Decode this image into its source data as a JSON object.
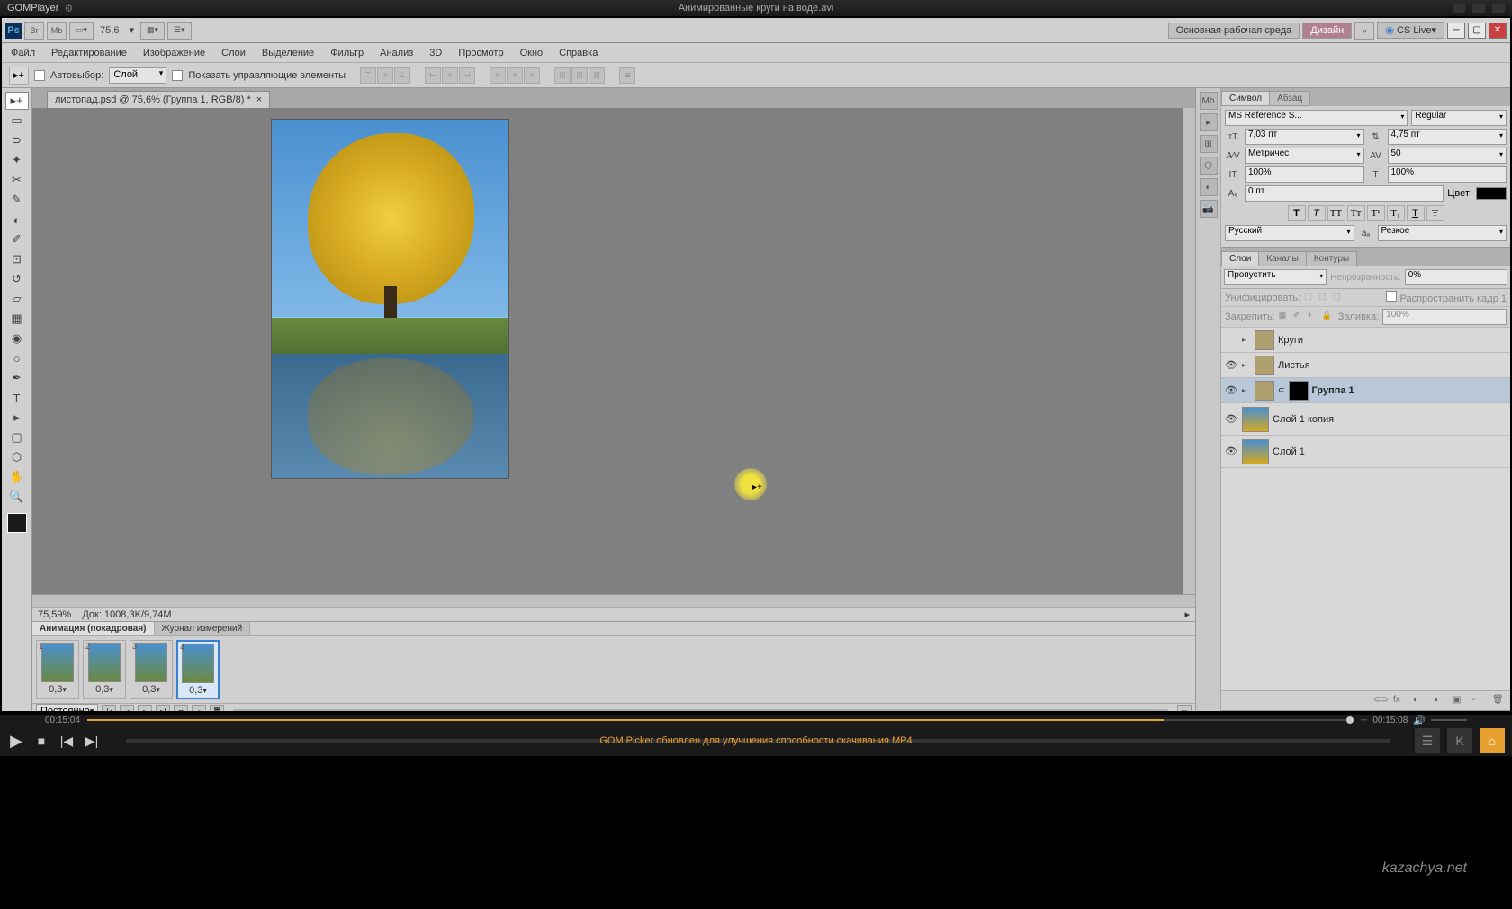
{
  "gom": {
    "logo": "GOM",
    "logo2": "Player",
    "title": "Анимированные круги на воде.avi",
    "time_current": "00:15:04",
    "time_total": "00:15:08",
    "message": "GOM Picker обновлен для улучшения способности скачивания MP4"
  },
  "ps": {
    "toolbar": {
      "zoom_preset": "75,6",
      "workspace_label": "Основная рабочая среда",
      "workspace_active": "Дизайн",
      "cslive": "CS Live"
    },
    "menu": [
      "Файл",
      "Редактирование",
      "Изображение",
      "Слои",
      "Выделение",
      "Фильтр",
      "Анализ",
      "3D",
      "Просмотр",
      "Окно",
      "Справка"
    ],
    "options": {
      "autoselect": "Автовыбор:",
      "autoselect_target": "Слой",
      "show_controls": "Показать управляющие элементы"
    },
    "doc_tab": "листопад.psd @ 75,6% (Группа 1, RGB/8) *",
    "status": {
      "zoom": "75,59%",
      "doc": "Док: 1008,3K/9,74M"
    },
    "animation": {
      "tab1": "Анимация (покадровая)",
      "tab2": "Журнал измерений",
      "loop": "Постоянно",
      "frames": [
        {
          "num": "1",
          "delay": "0,3"
        },
        {
          "num": "2",
          "delay": "0,3"
        },
        {
          "num": "3",
          "delay": "0,3"
        },
        {
          "num": "4",
          "delay": "0,3"
        }
      ]
    },
    "char_panel": {
      "tab1": "Символ",
      "tab2": "Абзац",
      "font": "MS Reference S...",
      "style": "Regular",
      "size": "7,03 пт",
      "leading": "4,75 пт",
      "kerning": "Метричес",
      "tracking": "50",
      "vscale": "100%",
      "hscale": "100%",
      "baseline": "0 пт",
      "color_label": "Цвет:",
      "lang": "Русский",
      "aa": "Резкое"
    },
    "layers_panel": {
      "tab1": "Слои",
      "tab2": "Каналы",
      "tab3": "Контуры",
      "blend": "Пропустить",
      "opacity_label": "Непрозрачность:",
      "opacity": "0%",
      "unify_label": "Унифицировать:",
      "propagate": "Распространить кадр 1",
      "lock_label": "Закрепить:",
      "fill_label": "Заливка:",
      "fill": "100%",
      "layers": [
        {
          "name": "Круги",
          "type": "group"
        },
        {
          "name": "Листья",
          "type": "group"
        },
        {
          "name": "Группа 1",
          "type": "group",
          "selected": true,
          "mask": true
        },
        {
          "name": "Слой 1 копия",
          "type": "layer"
        },
        {
          "name": "Слой 1",
          "type": "layer"
        }
      ]
    }
  },
  "watermark": "kazachya.net"
}
